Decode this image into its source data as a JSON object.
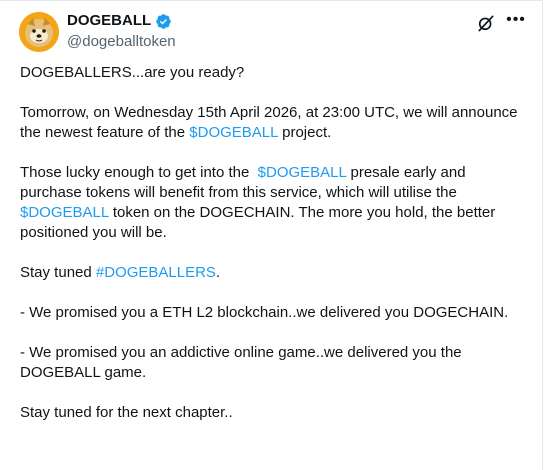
{
  "author": {
    "name": "DOGEBALL",
    "handle": "@dogeballtoken",
    "verified_icon": "verified-badge-icon",
    "avatar_icon": "doge-avatar"
  },
  "icons": {
    "grok": "grok-icon",
    "more": "more-icon"
  },
  "colors": {
    "link": "#1d9bf0",
    "text": "#0f1419",
    "muted": "#536471",
    "verified": "#1d9bf0"
  },
  "tweet": {
    "p1": "DOGEBALLERS...are you ready?",
    "p2_a": "Tomorrow, on Wednesday 15th April 2026, at 23:00 UTC, we will announce the newest feature of the ",
    "p2_link": "$DOGEBALL",
    "p2_b": " project.",
    "p3_a": "Those lucky enough to get into the  ",
    "p3_link1": "$DOGEBALL",
    "p3_b": " presale early and purchase tokens will benefit from this service, which will utilise the ",
    "p3_link2": "$DOGEBALL",
    "p3_c": " token on the DOGECHAIN. The more you hold, the better positioned you will be.",
    "p4_a": "Stay tuned ",
    "p4_link": "#DOGEBALLERS",
    "p4_b": ".",
    "p5": "- We promised you a ETH L2 blockchain..we delivered you DOGECHAIN.",
    "p6": "- We promised you an addictive online game..we delivered you the DOGEBALL game.",
    "p7": "Stay tuned for the next chapter.."
  }
}
